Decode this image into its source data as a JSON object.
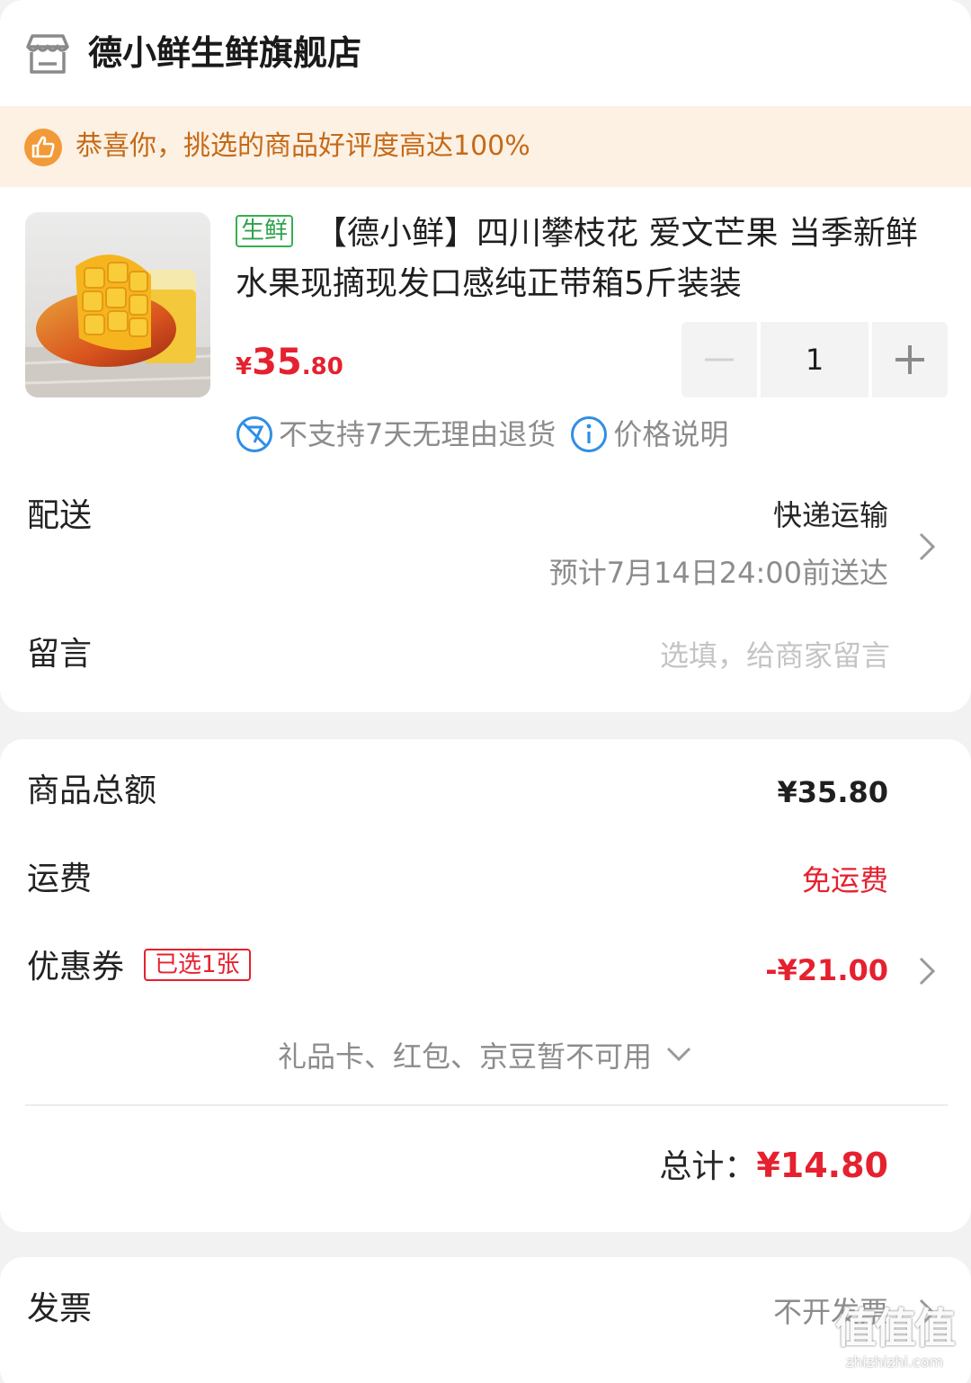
{
  "store": {
    "name": "德小鲜生鲜旗舰店",
    "icon": "store-icon"
  },
  "banner": {
    "text": "恭喜你，挑选的商品好评度高达100%",
    "icon": "thumbs-up-icon"
  },
  "product": {
    "tag": "生鲜",
    "title": "【德小鲜】四川攀枝花 爱文芒果 当季新鲜水果现摘现发口感纯正带箱5斤装装",
    "price_symbol": "¥",
    "price_integer": "35",
    "price_decimal": ".80",
    "quantity": "1",
    "policy_no_return": "不支持7天无理由退货",
    "policy_price_info": "价格说明"
  },
  "delivery": {
    "label": "配送",
    "method": "快递运输",
    "estimate": "预计7月14日24:00前送达"
  },
  "message": {
    "label": "留言",
    "placeholder": "选填，给商家留言"
  },
  "summary": {
    "goods_total_label": "商品总额",
    "goods_total": "¥35.80",
    "shipping_label": "运费",
    "shipping_value": "免运费",
    "coupon_label": "优惠券",
    "coupon_tag": "已选1张",
    "coupon_value": "-¥21.00",
    "unavailable": "礼品卡、红包、京豆暂不可用",
    "total_label": "总计：",
    "total_value": "¥14.80"
  },
  "invoice": {
    "label": "发票",
    "value": "不开发票"
  },
  "watermark": {
    "glyphs": "值值值",
    "url": "zhizhizhi.com"
  },
  "colors": {
    "accent_red": "#e5212f",
    "fresh_green": "#2da24a",
    "banner_bg": "#fdf1e4",
    "banner_text": "#c56a17",
    "info_blue": "#2f8ee5"
  }
}
